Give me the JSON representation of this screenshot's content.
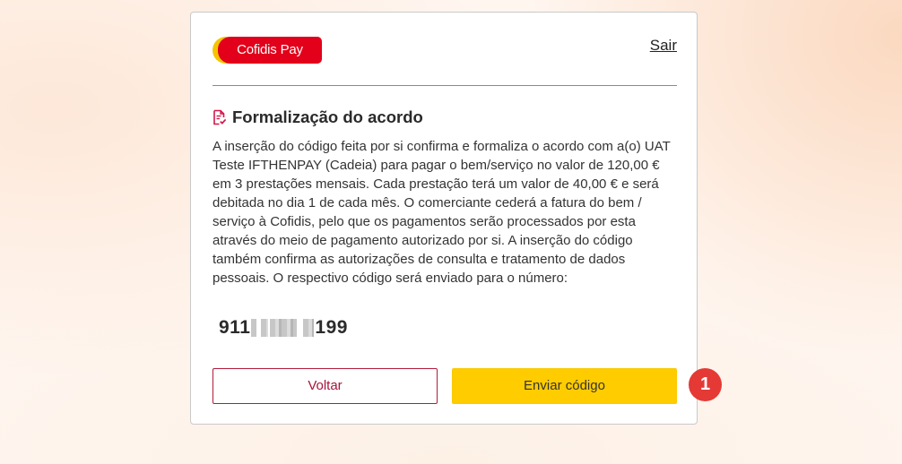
{
  "header": {
    "logo_text": "Cofidis Pay",
    "exit_link": "Sair"
  },
  "section": {
    "icon": "document-check-icon",
    "title": "Formalização do acordo",
    "paragraph": "A inserção do código feita por si confirma e formaliza o acordo com a(o) UAT Teste IFTHENPAY (Cadeia) para pagar o bem/serviço no valor de 120,00 € em 3 prestações mensais. Cada prestação terá um valor de 40,00 € e será debitada no dia 1 de cada mês. O comerciante cederá a fatura do bem / serviço à Cofidis, pelo que os pagamentos serão processados por esta através do meio de pagamento autorizado por si. A inserção do código também confirma as autorizações de consulta e tratamento de dados pessoais. O respectivo código será enviado para o número:"
  },
  "phone": {
    "prefix": "911",
    "suffix": "199"
  },
  "buttons": {
    "back_label": "Voltar",
    "send_label": "Enviar código"
  },
  "annotation": {
    "step_number": "1"
  },
  "colors": {
    "brand_red": "#e2001a",
    "brand_yellow": "#ffcc00",
    "back_border": "#b01c3a",
    "badge_red": "#e53935"
  }
}
